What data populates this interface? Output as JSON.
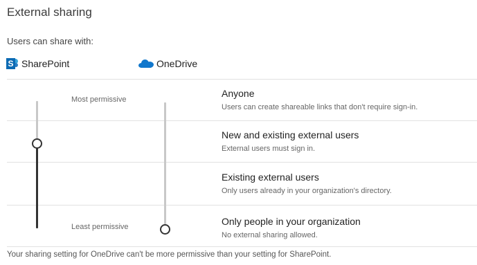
{
  "title": "External sharing",
  "subtitle": "Users can share with:",
  "brands": {
    "sharepoint": {
      "label": "SharePoint",
      "icon": "sharepoint-logo-icon",
      "color": "#0b6ab3"
    },
    "onedrive": {
      "label": "OneDrive",
      "icon": "onedrive-cloud-icon",
      "color": "#1177cc"
    }
  },
  "scale": {
    "most_label": "Most permissive",
    "least_label": "Least permissive"
  },
  "options": [
    {
      "title": "Anyone",
      "description": "Users can create shareable links that don't require sign-in."
    },
    {
      "title": "New and existing external users",
      "description": "External users must sign in."
    },
    {
      "title": "Existing external users",
      "description": "Only users already in your organization's directory."
    },
    {
      "title": "Only people in your organization",
      "description": "No external sharing allowed."
    }
  ],
  "sliders": {
    "sharepoint_level": "New and existing external users",
    "onedrive_level": "Only people in your organization"
  },
  "footer": "Your sharing setting for OneDrive can't be more permissive than your setting for SharePoint."
}
